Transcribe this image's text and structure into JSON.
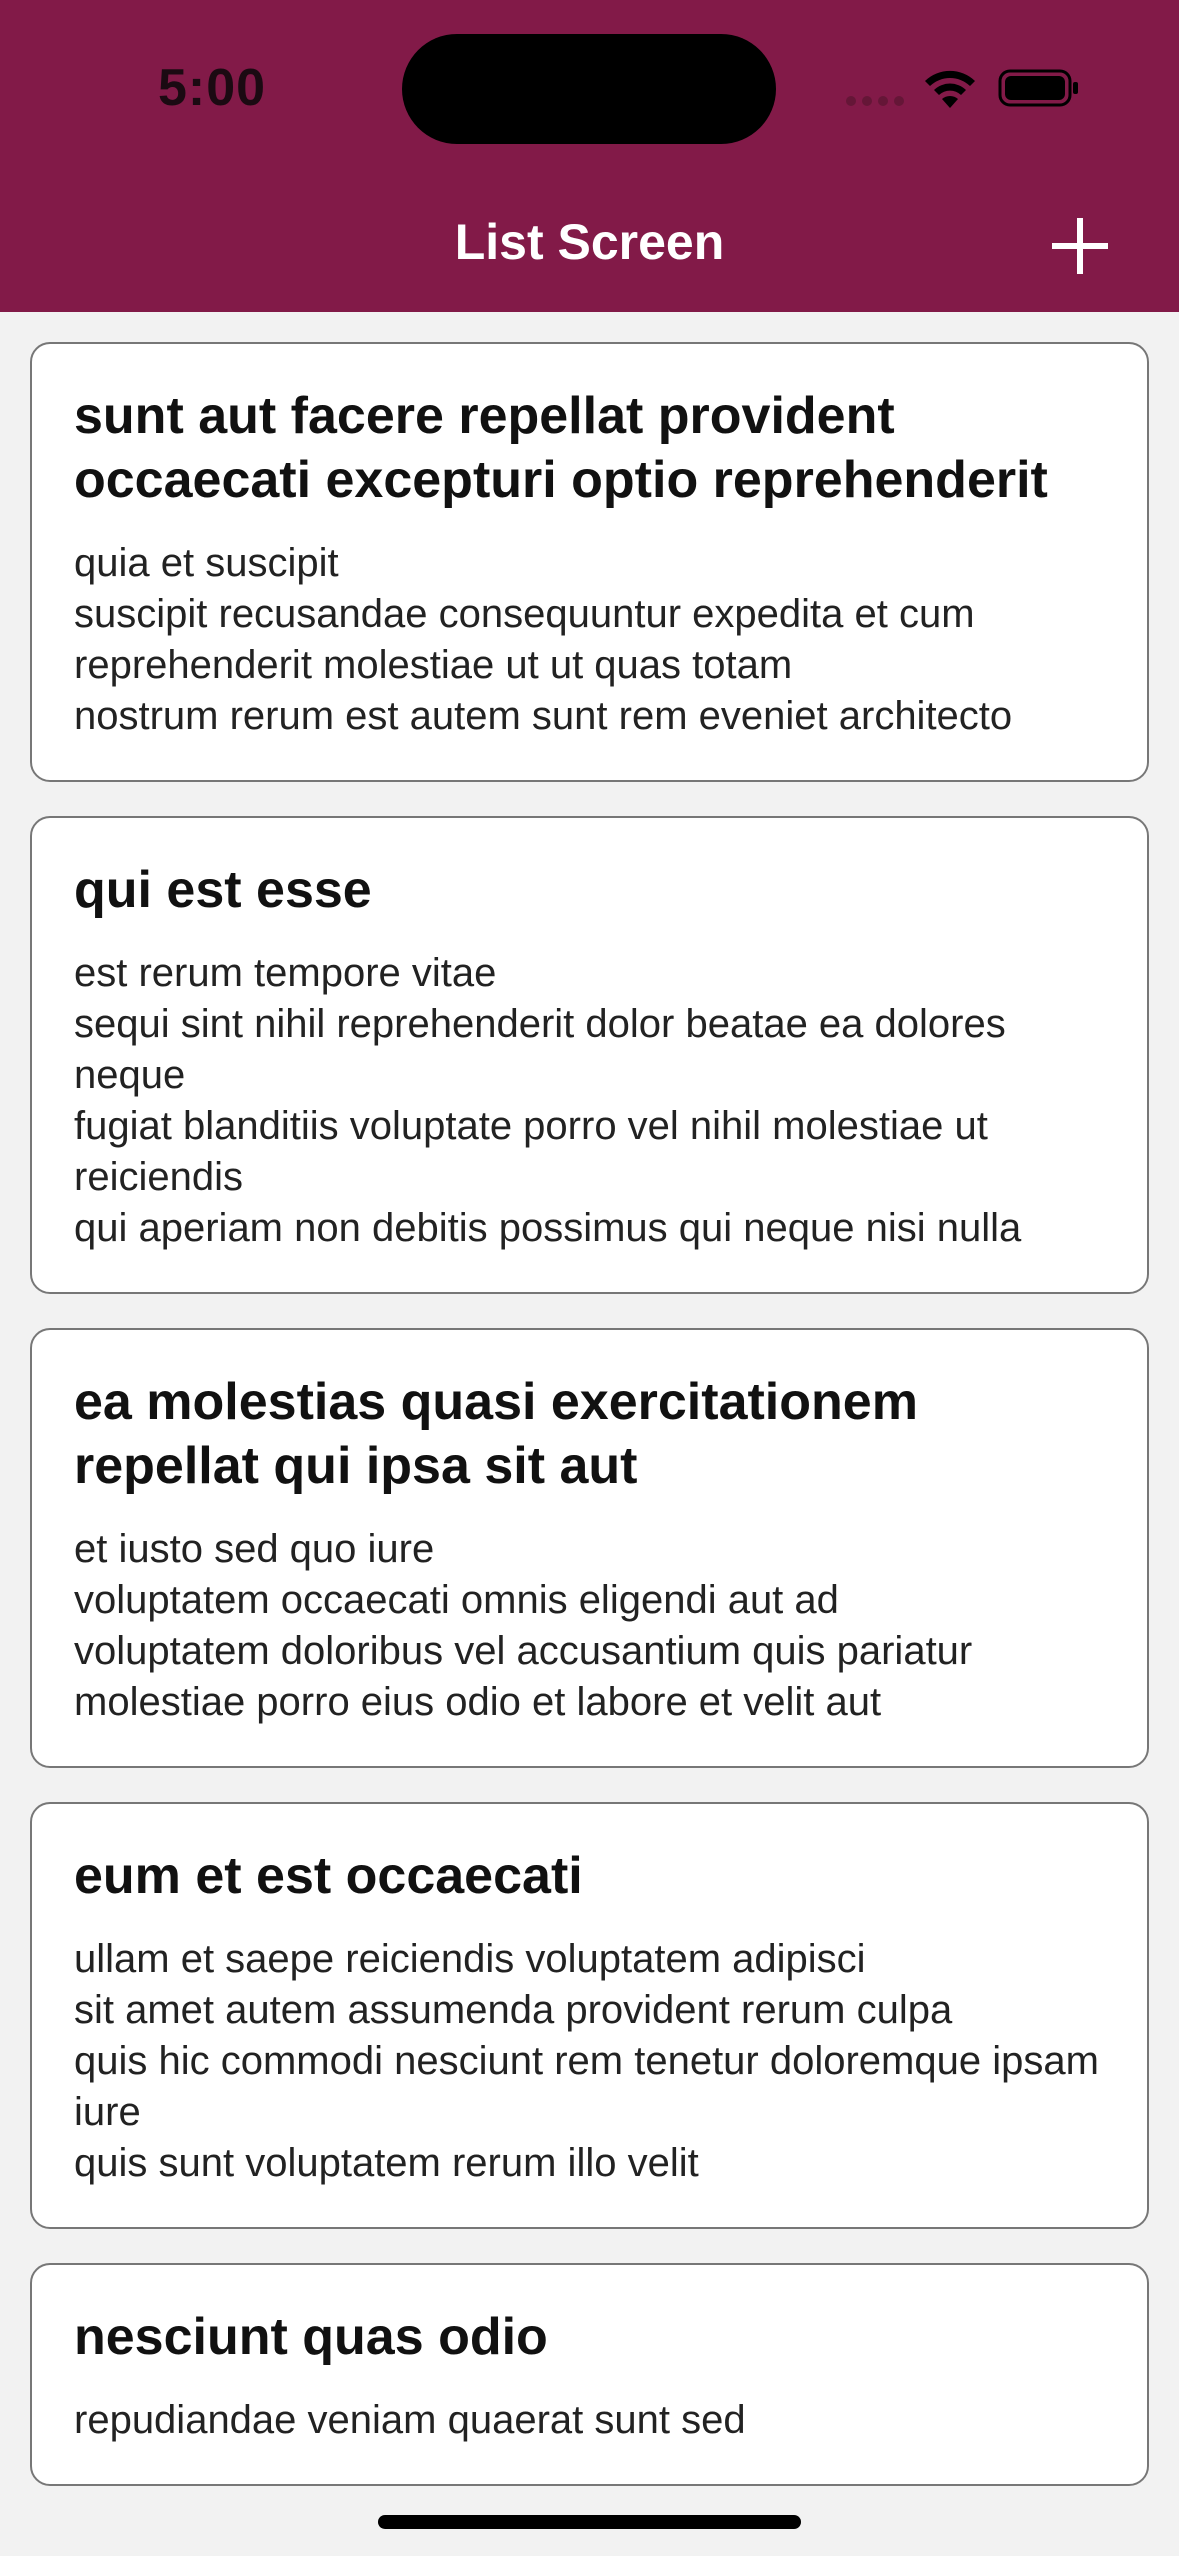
{
  "status_bar": {
    "time": "5:00"
  },
  "header": {
    "title": "List Screen",
    "add_icon": "plus-icon"
  },
  "colors": {
    "header_bg": "#821a48",
    "page_bg": "#f2f2f2",
    "card_bg": "#ffffff",
    "card_border": "#777777"
  },
  "posts": [
    {
      "title": "sunt aut facere repellat provident occaecati excepturi optio reprehenderit",
      "body": "quia et suscipit\nsuscipit recusandae consequuntur expedita et cum reprehenderit molestiae ut ut quas totam\nnostrum rerum est autem sunt rem eveniet architecto"
    },
    {
      "title": "qui est esse",
      "body": "est rerum tempore vitae\nsequi sint nihil reprehenderit dolor beatae ea dolores neque\nfugiat blanditiis voluptate porro vel nihil molestiae ut reiciendis\nqui aperiam non debitis possimus qui neque nisi nulla"
    },
    {
      "title": "ea molestias quasi exercitationem repellat qui ipsa sit aut",
      "body": "et iusto sed quo iure\nvoluptatem occaecati omnis eligendi aut ad\nvoluptatem doloribus vel accusantium quis pariatur\nmolestiae porro eius odio et labore et velit aut"
    },
    {
      "title": "eum et est occaecati",
      "body": "ullam et saepe reiciendis voluptatem adipisci\nsit amet autem assumenda provident rerum culpa\nquis hic commodi nesciunt rem tenetur doloremque ipsam iure\nquis sunt voluptatem rerum illo velit"
    },
    {
      "title": "nesciunt quas odio",
      "body": "repudiandae veniam quaerat sunt sed"
    }
  ]
}
